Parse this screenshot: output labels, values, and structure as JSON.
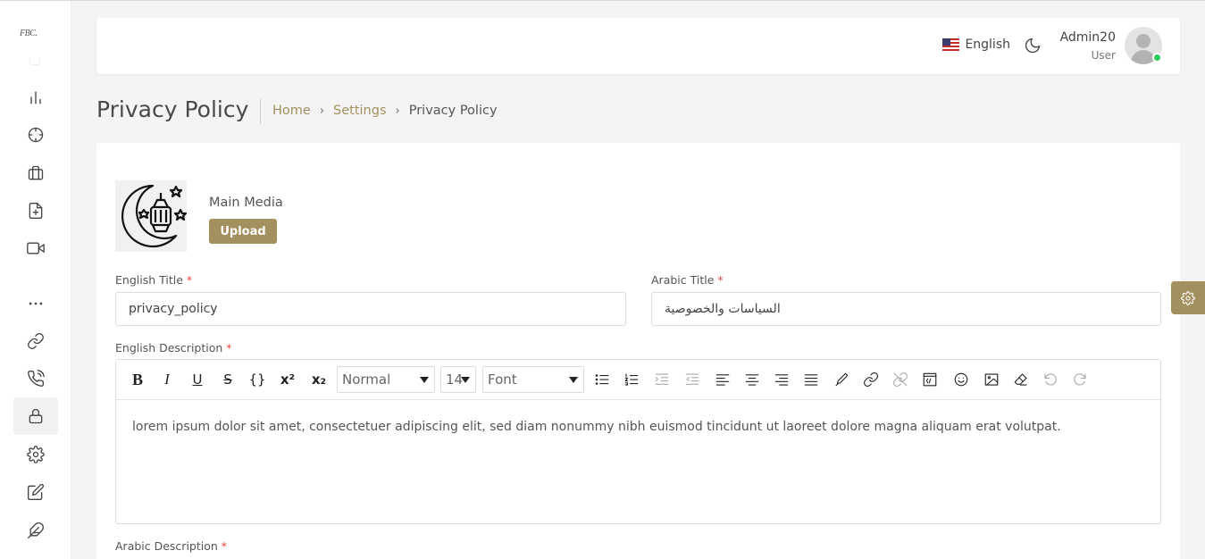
{
  "sidebar": {
    "logo": "FBC.",
    "items": [
      {
        "icon": "bar-chart-icon"
      },
      {
        "icon": "crosshair-icon"
      },
      {
        "icon": "briefcase-icon"
      },
      {
        "icon": "file-plus-icon"
      },
      {
        "icon": "video-icon"
      },
      {
        "icon": "more-horizontal-icon"
      },
      {
        "icon": "link-icon"
      },
      {
        "icon": "phone-call-icon"
      },
      {
        "icon": "lock-icon",
        "active": true
      },
      {
        "icon": "settings-icon"
      },
      {
        "icon": "edit-icon"
      },
      {
        "icon": "feather-icon"
      }
    ]
  },
  "header": {
    "language": "English",
    "user_name": "Admin20",
    "user_role": "User"
  },
  "page": {
    "title": "Privacy Policy",
    "breadcrumb": {
      "home": "Home",
      "settings": "Settings",
      "current": "Privacy Policy"
    }
  },
  "form": {
    "media_label": "Main Media",
    "upload_label": "Upload",
    "english_title_label": "English Title",
    "english_title_value": "privacy_policy",
    "arabic_title_label": "Arabic Title",
    "arabic_title_value": "السياسات والخصوصية",
    "english_description_label": "English Description",
    "english_description_value": "lorem ipsum dolor sit amet, consectetuer adipiscing elit, sed diam nonummy nibh euismod tincidunt ut laoreet dolore magna aliquam erat volutpat.",
    "arabic_description_label": "Arabic Description",
    "required_mark": "*"
  },
  "toolbar": {
    "paragraph_style": "Normal",
    "font_size": "14",
    "font_family": "Font"
  },
  "colors": {
    "accent": "#a2905e",
    "online": "#2ec95c",
    "required": "#e04848"
  }
}
